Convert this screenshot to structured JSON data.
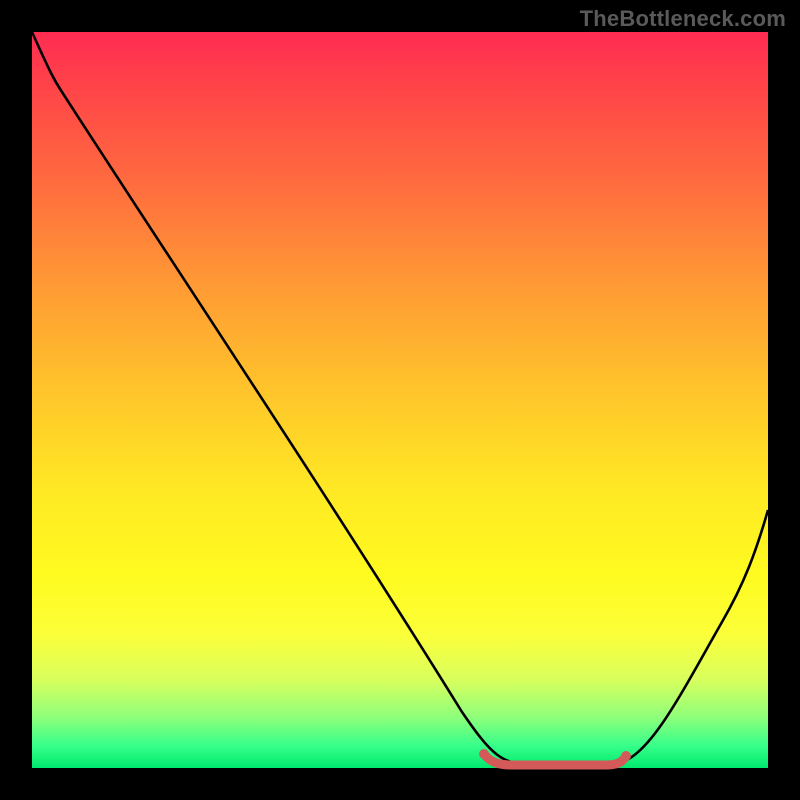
{
  "watermark": "TheBottleneck.com",
  "colors": {
    "frame": "#000000",
    "curve": "#000000",
    "trough_marker": "#d45a5a",
    "gradient_top": "#ff2c52",
    "gradient_bottom": "#00e86f"
  },
  "chart_data": {
    "type": "line",
    "title": "",
    "xlabel": "",
    "ylabel": "",
    "xlim": [
      0,
      100
    ],
    "ylim": [
      0,
      100
    ],
    "series": [
      {
        "name": "bottleneck-curve",
        "x": [
          0,
          4,
          10,
          20,
          30,
          40,
          50,
          58,
          62,
          66,
          72,
          78,
          82,
          88,
          94,
          100
        ],
        "y": [
          100,
          93,
          84,
          70,
          56,
          42,
          28,
          14,
          6,
          1,
          0,
          0,
          2,
          10,
          22,
          36
        ]
      }
    ],
    "trough_marker": {
      "x_start": 62,
      "x_end": 80,
      "y": 0.5
    },
    "annotations": []
  }
}
